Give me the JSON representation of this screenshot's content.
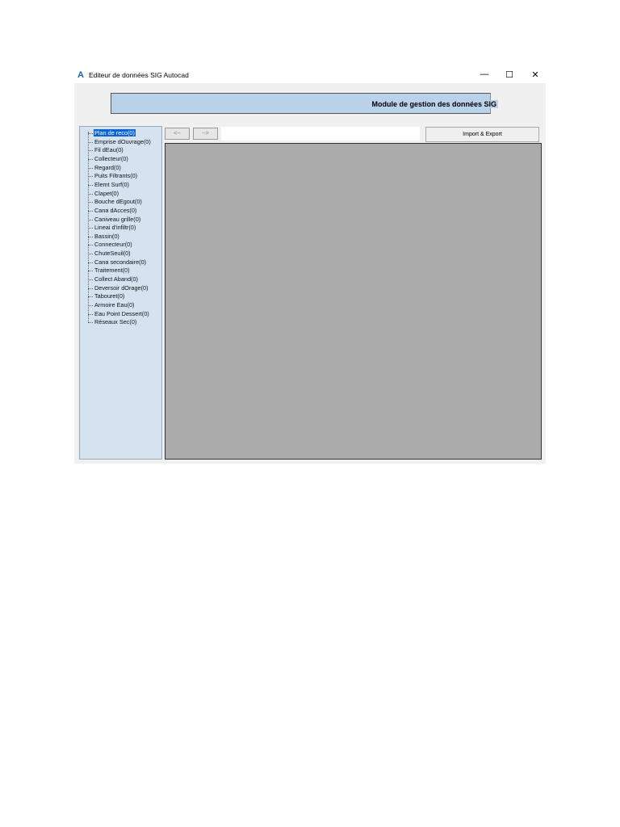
{
  "window": {
    "title": "Editeur de données SIG Autocad",
    "minimize": "—",
    "maximize": "☐",
    "close": "✕"
  },
  "banner": {
    "text": "Module de gestion des données SIG"
  },
  "nav": {
    "back": "<--",
    "forward": "-->",
    "address": ""
  },
  "import_export": "Import & Export",
  "tree": {
    "selected_index": 0,
    "items": [
      "Plan de reco(0)",
      "Emprise dOuvrage(0)",
      "Fil dEau(0)",
      "Collecteur(0)",
      "Regard(0)",
      "Puits Filtrants(0)",
      "Elemt Surf(0)",
      "Clapet(0)",
      "Bouche dEgout(0)",
      "Cana dAcces(0)",
      "Caniveau grille(0)",
      "Lineai d'infiltr(0)",
      "Bassin(0)",
      "Connecteur(0)",
      "ChuteSeuil(0)",
      "Cana secondaire(0)",
      "Traitement(0)",
      "Collect Aband(0)",
      "Deversoir dOrage(0)",
      "Tabouret(0)",
      "Armoire Eau(0)",
      "Eau Point Dessert(0)",
      "Réseaux Sec(0)"
    ]
  }
}
